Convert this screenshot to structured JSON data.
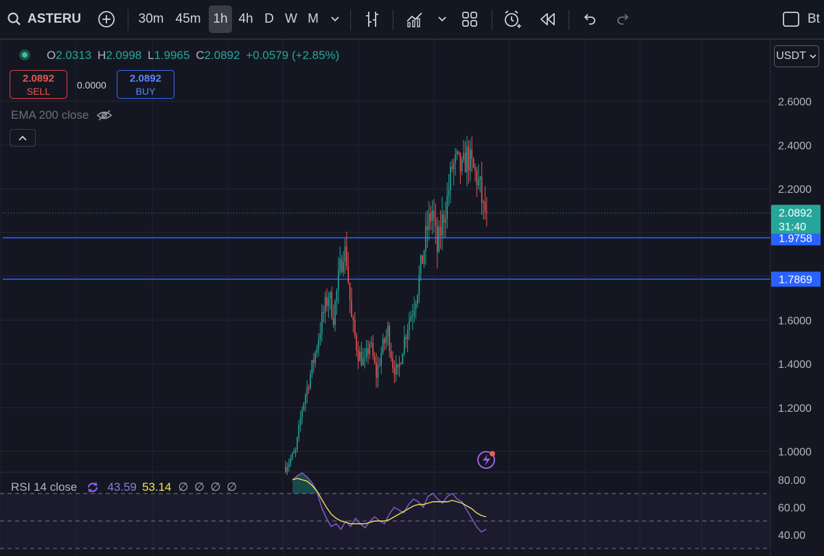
{
  "toolbar": {
    "symbol": "ASTERU",
    "intervals": [
      "30m",
      "45m",
      "1h",
      "4h",
      "D",
      "W",
      "M"
    ],
    "active_interval": "1h",
    "right_text": "Bt"
  },
  "legend": {
    "o_label": "O",
    "o": "2.0313",
    "h_label": "H",
    "h": "2.0998",
    "l_label": "L",
    "l": "1.9965",
    "c_label": "C",
    "c": "2.0892",
    "change": "+0.0579 (+2.85%)"
  },
  "trade": {
    "sell_price": "2.0892",
    "sell_label": "SELL",
    "spread": "0.0000",
    "buy_price": "2.0892",
    "buy_label": "BUY"
  },
  "indicators": {
    "ema_label": "EMA 200 close",
    "rsi_label": "RSI 14 close",
    "rsi_value": "43.59",
    "rsi_ma_value": "53.14",
    "rsi_extra": "∅ ∅ ∅ ∅"
  },
  "currency": "USDT",
  "colors": {
    "up": "#26a69a",
    "down": "#ef5350",
    "hline": "#2962ff",
    "rsi": "#7e57c2",
    "rsi_ma": "#f5e35a",
    "background": "#141722"
  },
  "chart_data": {
    "type": "candlestick",
    "price_axis": {
      "ticks": [
        2.6,
        2.4,
        2.2,
        1.6,
        1.4,
        1.2,
        1.0
      ],
      "tick_labels": [
        "2.6000",
        "2.4000",
        "2.2000",
        "1.6000",
        "1.4000",
        "1.2000",
        "1.0000"
      ]
    },
    "current_price": {
      "value": 2.0892,
      "label": "2.0892",
      "countdown": "31:40"
    },
    "horizontal_lines": [
      {
        "value": 1.9758,
        "label": "1.9758"
      },
      {
        "value": 1.7869,
        "label": "1.7869"
      }
    ],
    "price_path": [
      [
        0,
        0.93
      ],
      [
        6,
        1.0
      ],
      [
        10,
        1.2
      ],
      [
        14,
        1.32
      ],
      [
        18,
        1.45
      ],
      [
        22,
        1.6
      ],
      [
        26,
        1.72
      ],
      [
        29,
        1.62
      ],
      [
        32,
        1.78
      ],
      [
        35,
        1.93
      ],
      [
        37,
        1.88
      ],
      [
        40,
        1.6
      ],
      [
        44,
        1.45
      ],
      [
        48,
        1.4
      ],
      [
        51,
        1.5
      ],
      [
        55,
        1.35
      ],
      [
        58,
        1.45
      ],
      [
        62,
        1.55
      ],
      [
        65,
        1.4
      ],
      [
        68,
        1.35
      ],
      [
        71,
        1.48
      ],
      [
        74,
        1.58
      ],
      [
        77,
        1.65
      ],
      [
        80,
        1.75
      ],
      [
        83,
        1.88
      ],
      [
        86,
        2.02
      ],
      [
        89,
        2.1
      ],
      [
        92,
        1.92
      ],
      [
        95,
        2.05
      ],
      [
        98,
        2.15
      ],
      [
        101,
        2.3
      ],
      [
        104,
        2.32
      ],
      [
        107,
        2.28
      ],
      [
        110,
        2.35
      ],
      [
        113,
        2.3
      ],
      [
        116,
        2.25
      ],
      [
        118,
        2.2
      ],
      [
        120,
        2.1
      ],
      [
        122,
        2.09
      ]
    ],
    "rsi": {
      "ticks": [
        80,
        60,
        40
      ],
      "tick_labels": [
        "80.00",
        "60.00",
        "40.00"
      ],
      "bands": [
        70,
        50,
        30
      ],
      "values": [
        80,
        83,
        85,
        82,
        78,
        72,
        60,
        52,
        46,
        48,
        44,
        50,
        46,
        52,
        48,
        45,
        50,
        53,
        50,
        48,
        55,
        60,
        58,
        56,
        62,
        66,
        64,
        60,
        68,
        70,
        66,
        63,
        68,
        70,
        66,
        64,
        58,
        52,
        46,
        42,
        44
      ],
      "ma_values": [
        80,
        81,
        80,
        79,
        76,
        72,
        66,
        60,
        55,
        52,
        50,
        49,
        48,
        48,
        48,
        48,
        49,
        50,
        50,
        50,
        51,
        53,
        55,
        57,
        59,
        61,
        62,
        62,
        63,
        64,
        64,
        64,
        64,
        65,
        64,
        63,
        61,
        59,
        56,
        54,
        53
      ]
    }
  }
}
